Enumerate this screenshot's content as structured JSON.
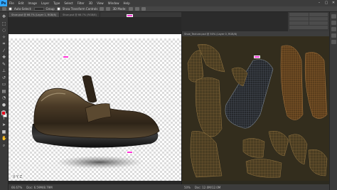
{
  "app": {
    "logo": "Ps",
    "menu": [
      "File",
      "Edit",
      "Image",
      "Layer",
      "Type",
      "Select",
      "Filter",
      "3D",
      "View",
      "Window",
      "Help"
    ],
    "window_controls": [
      "–",
      "▢",
      "✕"
    ]
  },
  "options_bar": {
    "auto_select_label": "Auto-Select:",
    "group_label": "Group",
    "transform_label": "Show Transform Controls",
    "mode_label": "3D Mode:"
  },
  "tabs": [
    {
      "label": "Shoe.psd @ 66.7% (Layer 1, RGB/8)"
    },
    {
      "label": "Shoe.psd @ 66.7% (RGB/8)"
    }
  ],
  "left_document": {
    "axis_label": "X  Y  Z",
    "status_zoom": "66.67%",
    "status_doc": "Doc: 6.59M/8.79M"
  },
  "uv_window": {
    "title": "Shoe_Texture.psd @ 50% (Layer 0, RGB/8)",
    "status_zoom": "50%",
    "status_doc": "Doc: 12.0M/12.0M"
  },
  "colors": {
    "foreground": "#e3001b",
    "background": "#ffffff",
    "marker": "#ff33d6",
    "shoe_leather": "#4a3a26",
    "uv_wire": "#8a6a3a"
  },
  "tools": [
    "move-icon",
    "marquee-icon",
    "lasso-icon",
    "wand-icon",
    "crop-icon",
    "eyedropper-icon",
    "heal-icon",
    "brush-icon",
    "stamp-icon",
    "history-brush-icon",
    "eraser-icon",
    "gradient-icon",
    "blur-icon",
    "dodge-icon",
    "pen-icon",
    "type-icon",
    "path-select-icon",
    "shape-icon",
    "hand-icon",
    "zoom-icon"
  ]
}
